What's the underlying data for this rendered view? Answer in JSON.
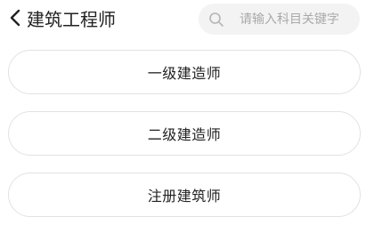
{
  "header": {
    "back_icon": "chevron-left-icon",
    "title": "建筑工程师"
  },
  "search": {
    "icon": "search-icon",
    "placeholder": "请输入科目关键字",
    "value": ""
  },
  "options": [
    {
      "label": "一级建造师"
    },
    {
      "label": "二级建造师"
    },
    {
      "label": "注册建筑师"
    }
  ]
}
